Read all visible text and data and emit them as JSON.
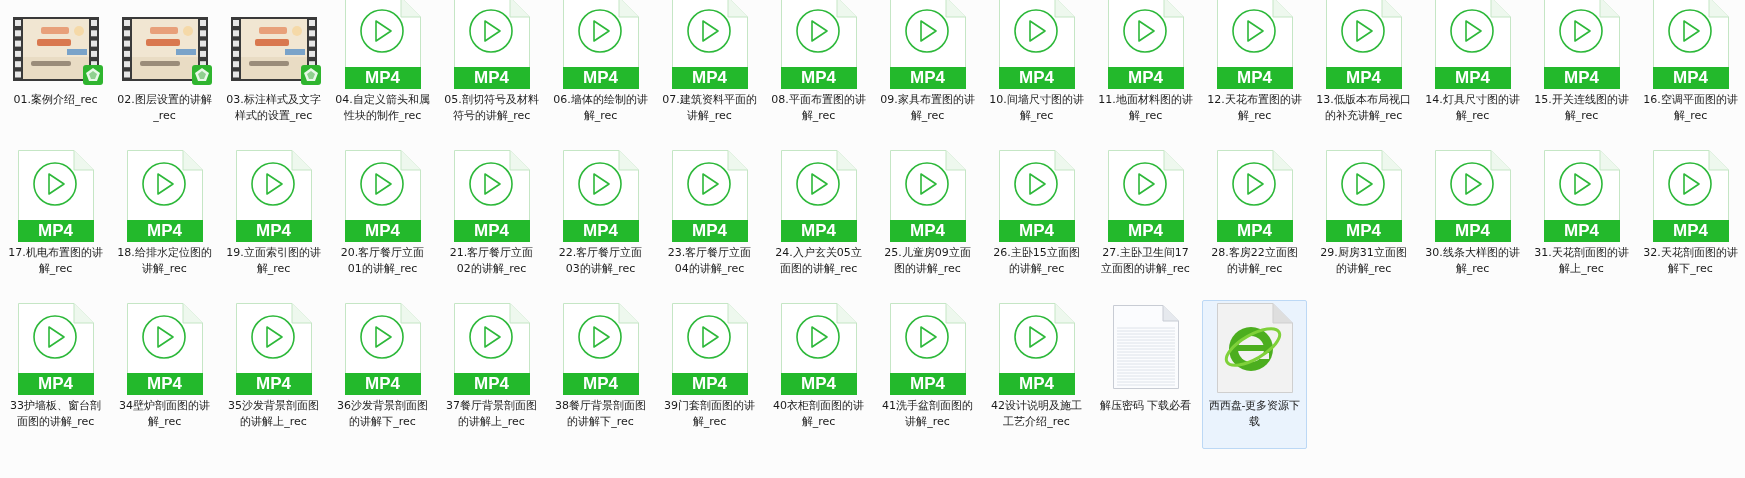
{
  "files": [
    {
      "kind": "video-thumb",
      "name": "01.案例介绍_rec",
      "selected": false
    },
    {
      "kind": "video-thumb",
      "name": "02.图层设置的讲解_rec",
      "selected": false
    },
    {
      "kind": "video-thumb",
      "name": "03.标注样式及文字样式的设置_rec",
      "selected": false
    },
    {
      "kind": "mp4",
      "badge": "MP4",
      "name": "04.自定义箭头和属性块的制作_rec",
      "selected": false
    },
    {
      "kind": "mp4",
      "badge": "MP4",
      "name": "05.剖切符号及材料符号的讲解_rec",
      "selected": false
    },
    {
      "kind": "mp4",
      "badge": "MP4",
      "name": "06.墙体的绘制的讲解_rec",
      "selected": false
    },
    {
      "kind": "mp4",
      "badge": "MP4",
      "name": "07.建筑资料平面的讲解_rec",
      "selected": false
    },
    {
      "kind": "mp4",
      "badge": "MP4",
      "name": "08.平面布置图的讲解_rec",
      "selected": false
    },
    {
      "kind": "mp4",
      "badge": "MP4",
      "name": "09.家具布置图的讲解_rec",
      "selected": false
    },
    {
      "kind": "mp4",
      "badge": "MP4",
      "name": "10.间墙尺寸图的讲解_rec",
      "selected": false
    },
    {
      "kind": "mp4",
      "badge": "MP4",
      "name": "11.地面材料图的讲解_rec",
      "selected": false
    },
    {
      "kind": "mp4",
      "badge": "MP4",
      "name": "12.天花布置图的讲解_rec",
      "selected": false
    },
    {
      "kind": "mp4",
      "badge": "MP4",
      "name": "13.低版本布局视口的补充讲解_rec",
      "selected": false
    },
    {
      "kind": "mp4",
      "badge": "MP4",
      "name": "14.灯具尺寸图的讲解_rec",
      "selected": false
    },
    {
      "kind": "mp4",
      "badge": "MP4",
      "name": "15.开关连线图的讲解_rec",
      "selected": false
    },
    {
      "kind": "mp4",
      "badge": "MP4",
      "name": "16.空调平面图的讲解_rec",
      "selected": false
    },
    {
      "kind": "mp4",
      "badge": "MP4",
      "name": "17.机电布置图的讲解_rec",
      "selected": false
    },
    {
      "kind": "mp4",
      "badge": "MP4",
      "name": "18.给排水定位图的讲解_rec",
      "selected": false
    },
    {
      "kind": "mp4",
      "badge": "MP4",
      "name": "19.立面索引图的讲解_rec",
      "selected": false
    },
    {
      "kind": "mp4",
      "badge": "MP4",
      "name": "20.客厅餐厅立面01的讲解_rec",
      "selected": false
    },
    {
      "kind": "mp4",
      "badge": "MP4",
      "name": "21.客厅餐厅立面02的讲解_rec",
      "selected": false
    },
    {
      "kind": "mp4",
      "badge": "MP4",
      "name": "22.客厅餐厅立面03的讲解_rec",
      "selected": false
    },
    {
      "kind": "mp4",
      "badge": "MP4",
      "name": "23.客厅餐厅立面04的讲解_rec",
      "selected": false
    },
    {
      "kind": "mp4",
      "badge": "MP4",
      "name": "24.入户玄关05立面图的讲解_rec",
      "selected": false
    },
    {
      "kind": "mp4",
      "badge": "MP4",
      "name": "25.儿童房09立面图的讲解_rec",
      "selected": false
    },
    {
      "kind": "mp4",
      "badge": "MP4",
      "name": "26.主卧15立面图的讲解_rec",
      "selected": false
    },
    {
      "kind": "mp4",
      "badge": "MP4",
      "name": "27.主卧卫生间17立面图的讲解_rec",
      "selected": false
    },
    {
      "kind": "mp4",
      "badge": "MP4",
      "name": "28.客房22立面图的讲解_rec",
      "selected": false
    },
    {
      "kind": "mp4",
      "badge": "MP4",
      "name": "29.厨房31立面图的讲解_rec",
      "selected": false
    },
    {
      "kind": "mp4",
      "badge": "MP4",
      "name": "30.线条大样图的讲解_rec",
      "selected": false
    },
    {
      "kind": "mp4",
      "badge": "MP4",
      "name": "31.天花剖面图的讲解上_rec",
      "selected": false
    },
    {
      "kind": "mp4",
      "badge": "MP4",
      "name": "32.天花剖面图的讲解下_rec",
      "selected": false
    },
    {
      "kind": "mp4",
      "badge": "MP4",
      "name": "33护墙板、窗台剖面图的讲解_rec",
      "selected": false
    },
    {
      "kind": "mp4",
      "badge": "MP4",
      "name": "34壁炉剖面图的讲解_rec",
      "selected": false
    },
    {
      "kind": "mp4",
      "badge": "MP4",
      "name": "35沙发背景剖面图的讲解上_rec",
      "selected": false
    },
    {
      "kind": "mp4",
      "badge": "MP4",
      "name": "36沙发背景剖面图的讲解下_rec",
      "selected": false
    },
    {
      "kind": "mp4",
      "badge": "MP4",
      "name": "37餐厅背景剖面图的讲解上_rec",
      "selected": false
    },
    {
      "kind": "mp4",
      "badge": "MP4",
      "name": "38餐厅背景剖面图的讲解下_rec",
      "selected": false
    },
    {
      "kind": "mp4",
      "badge": "MP4",
      "name": "39门套剖面图的讲解_rec",
      "selected": false
    },
    {
      "kind": "mp4",
      "badge": "MP4",
      "name": "40衣柜剖面图的讲解_rec",
      "selected": false
    },
    {
      "kind": "mp4",
      "badge": "MP4",
      "name": "41洗手盆剖面图的讲解_rec",
      "selected": false
    },
    {
      "kind": "mp4",
      "badge": "MP4",
      "name": "42设计说明及施工工艺介绍_rec",
      "selected": false
    },
    {
      "kind": "text",
      "name": "解压密码 下载必看",
      "selected": false
    },
    {
      "kind": "web",
      "name": "西西盘-更多资源下载",
      "selected": true
    }
  ]
}
